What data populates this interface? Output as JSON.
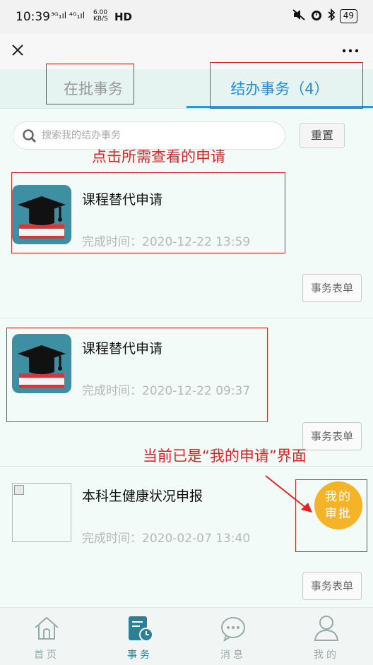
{
  "status_bar": {
    "time": "10:39",
    "signal_text": "³ᴳ₁ıl ⁴ᴳ₁ıl",
    "speed": "6.00 KB/S",
    "hd": "HD",
    "battery": "49"
  },
  "tabs": [
    {
      "label": "在批事务"
    },
    {
      "label": "结办事务（4）"
    }
  ],
  "search": {
    "placeholder": "搜索我的结办事务",
    "reset_label": "重置"
  },
  "annotations": {
    "click_hint": "点击所需查看的申请",
    "current_hint": "当前已是“我的申请”界面"
  },
  "items": [
    {
      "title": "课程替代申请",
      "time": "完成时间：2020-12-22 13:59",
      "action": "事务表单"
    },
    {
      "title": "课程替代申请",
      "time": "完成时间：2020-12-22 09:37",
      "action": "事务表单"
    },
    {
      "title": "本科生健康状况申报",
      "time": "完成时间：2020-02-07 13:40",
      "action": "事务表单"
    }
  ],
  "float_button": {
    "line1": "我的",
    "line2": "审批"
  },
  "bottom_nav": [
    {
      "label": "首页"
    },
    {
      "label": "事务"
    },
    {
      "label": "消息"
    },
    {
      "label": "我的"
    }
  ],
  "colors": {
    "accent": "#1f8fe0",
    "annotation": "#e52222",
    "float_button": "#f5b328",
    "icon_bg": "#3f8fa3"
  }
}
